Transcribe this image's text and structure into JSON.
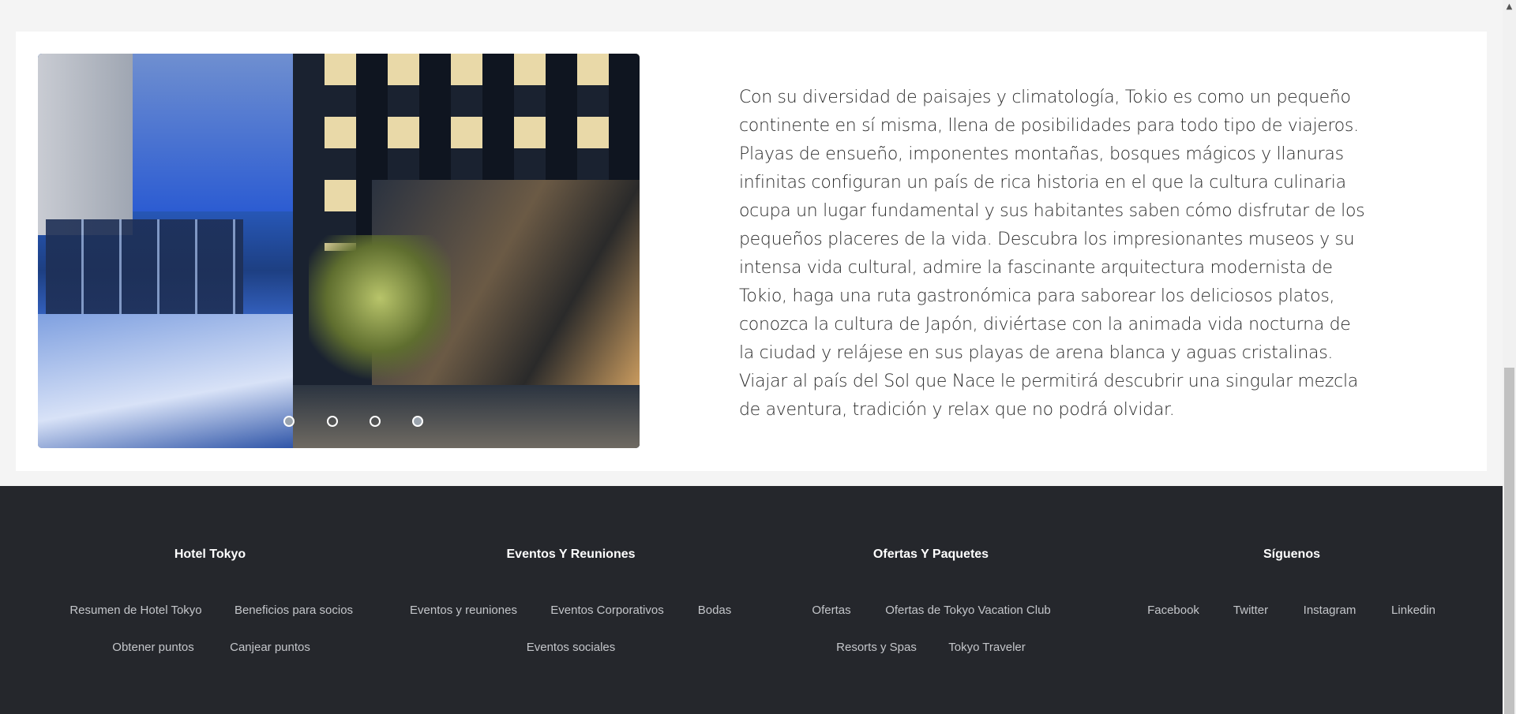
{
  "carousel": {
    "slides": 4,
    "active_index": 0,
    "dot_labels": [
      "slide-1",
      "slide-2",
      "slide-3",
      "slide-4"
    ]
  },
  "content": {
    "description": "Con su diversidad de paisajes y climatología, Tokio es como un pequeño continente en sí misma, llena de posibilidades para todo tipo de viajeros. Playas de ensueño, imponentes montañas, bosques mágicos y llanuras infinitas configuran un país de rica historia en el que la cultura culinaria ocupa un lugar fundamental y sus habitantes saben cómo disfrutar de los pequeños placeres de la vida. Descubra los impresionantes museos y su intensa vida cultural, admire la fascinante arquitectura modernista de Tokio, haga una ruta gastronómica para saborear los deliciosos platos, conozca la cultura de Japón, diviértase con la animada vida nocturna de la ciudad y relájese en sus playas de arena blanca y aguas cristalinas. Viajar al país del Sol que Nace le permitirá descubrir una singular mezcla de aventura, tradición y relax que no podrá olvidar."
  },
  "footer": {
    "columns": [
      {
        "title": "Hotel Tokyo",
        "links": [
          "Resumen de Hotel Tokyo",
          "Beneficios para socios",
          "Obtener puntos",
          "Canjear puntos"
        ]
      },
      {
        "title": "Eventos Y Reuniones",
        "links": [
          "Eventos y reuniones",
          "Eventos Corporativos",
          "Bodas",
          "Eventos sociales"
        ]
      },
      {
        "title": "Ofertas Y Paquetes",
        "links": [
          "Ofertas",
          "Ofertas de Tokyo Vacation Club",
          "Resorts y Spas",
          "Tokyo Traveler"
        ]
      },
      {
        "title": "Síguenos",
        "links": [
          "Facebook",
          "Twitter",
          "Instagram",
          "Linkedin"
        ]
      }
    ]
  },
  "colors": {
    "page_bg": "#f4f4f4",
    "card_bg": "#ffffff",
    "footer_bg": "#25272c",
    "footer_title": "#ffffff",
    "footer_link": "#c4c6ca",
    "text": "#2b2b2b"
  },
  "icons": {
    "scroll_up": "▲"
  }
}
